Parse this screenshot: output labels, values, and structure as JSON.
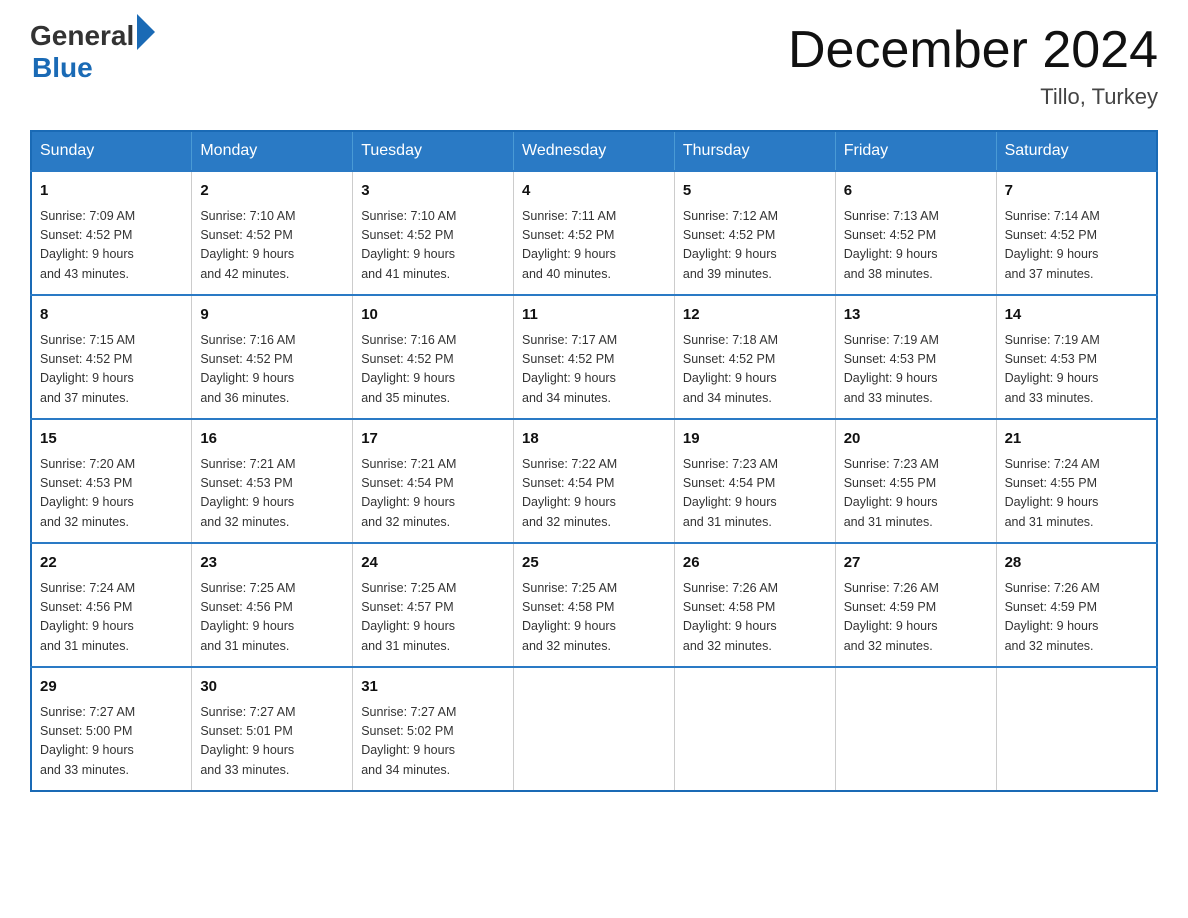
{
  "header": {
    "logo_general": "General",
    "logo_blue": "Blue",
    "month_title": "December 2024",
    "location": "Tillo, Turkey"
  },
  "weekdays": [
    "Sunday",
    "Monday",
    "Tuesday",
    "Wednesday",
    "Thursday",
    "Friday",
    "Saturday"
  ],
  "weeks": [
    [
      {
        "day": "1",
        "sunrise": "7:09 AM",
        "sunset": "4:52 PM",
        "daylight": "9 hours and 43 minutes."
      },
      {
        "day": "2",
        "sunrise": "7:10 AM",
        "sunset": "4:52 PM",
        "daylight": "9 hours and 42 minutes."
      },
      {
        "day": "3",
        "sunrise": "7:10 AM",
        "sunset": "4:52 PM",
        "daylight": "9 hours and 41 minutes."
      },
      {
        "day": "4",
        "sunrise": "7:11 AM",
        "sunset": "4:52 PM",
        "daylight": "9 hours and 40 minutes."
      },
      {
        "day": "5",
        "sunrise": "7:12 AM",
        "sunset": "4:52 PM",
        "daylight": "9 hours and 39 minutes."
      },
      {
        "day": "6",
        "sunrise": "7:13 AM",
        "sunset": "4:52 PM",
        "daylight": "9 hours and 38 minutes."
      },
      {
        "day": "7",
        "sunrise": "7:14 AM",
        "sunset": "4:52 PM",
        "daylight": "9 hours and 37 minutes."
      }
    ],
    [
      {
        "day": "8",
        "sunrise": "7:15 AM",
        "sunset": "4:52 PM",
        "daylight": "9 hours and 37 minutes."
      },
      {
        "day": "9",
        "sunrise": "7:16 AM",
        "sunset": "4:52 PM",
        "daylight": "9 hours and 36 minutes."
      },
      {
        "day": "10",
        "sunrise": "7:16 AM",
        "sunset": "4:52 PM",
        "daylight": "9 hours and 35 minutes."
      },
      {
        "day": "11",
        "sunrise": "7:17 AM",
        "sunset": "4:52 PM",
        "daylight": "9 hours and 34 minutes."
      },
      {
        "day": "12",
        "sunrise": "7:18 AM",
        "sunset": "4:52 PM",
        "daylight": "9 hours and 34 minutes."
      },
      {
        "day": "13",
        "sunrise": "7:19 AM",
        "sunset": "4:53 PM",
        "daylight": "9 hours and 33 minutes."
      },
      {
        "day": "14",
        "sunrise": "7:19 AM",
        "sunset": "4:53 PM",
        "daylight": "9 hours and 33 minutes."
      }
    ],
    [
      {
        "day": "15",
        "sunrise": "7:20 AM",
        "sunset": "4:53 PM",
        "daylight": "9 hours and 32 minutes."
      },
      {
        "day": "16",
        "sunrise": "7:21 AM",
        "sunset": "4:53 PM",
        "daylight": "9 hours and 32 minutes."
      },
      {
        "day": "17",
        "sunrise": "7:21 AM",
        "sunset": "4:54 PM",
        "daylight": "9 hours and 32 minutes."
      },
      {
        "day": "18",
        "sunrise": "7:22 AM",
        "sunset": "4:54 PM",
        "daylight": "9 hours and 32 minutes."
      },
      {
        "day": "19",
        "sunrise": "7:23 AM",
        "sunset": "4:54 PM",
        "daylight": "9 hours and 31 minutes."
      },
      {
        "day": "20",
        "sunrise": "7:23 AM",
        "sunset": "4:55 PM",
        "daylight": "9 hours and 31 minutes."
      },
      {
        "day": "21",
        "sunrise": "7:24 AM",
        "sunset": "4:55 PM",
        "daylight": "9 hours and 31 minutes."
      }
    ],
    [
      {
        "day": "22",
        "sunrise": "7:24 AM",
        "sunset": "4:56 PM",
        "daylight": "9 hours and 31 minutes."
      },
      {
        "day": "23",
        "sunrise": "7:25 AM",
        "sunset": "4:56 PM",
        "daylight": "9 hours and 31 minutes."
      },
      {
        "day": "24",
        "sunrise": "7:25 AM",
        "sunset": "4:57 PM",
        "daylight": "9 hours and 31 minutes."
      },
      {
        "day": "25",
        "sunrise": "7:25 AM",
        "sunset": "4:58 PM",
        "daylight": "9 hours and 32 minutes."
      },
      {
        "day": "26",
        "sunrise": "7:26 AM",
        "sunset": "4:58 PM",
        "daylight": "9 hours and 32 minutes."
      },
      {
        "day": "27",
        "sunrise": "7:26 AM",
        "sunset": "4:59 PM",
        "daylight": "9 hours and 32 minutes."
      },
      {
        "day": "28",
        "sunrise": "7:26 AM",
        "sunset": "4:59 PM",
        "daylight": "9 hours and 32 minutes."
      }
    ],
    [
      {
        "day": "29",
        "sunrise": "7:27 AM",
        "sunset": "5:00 PM",
        "daylight": "9 hours and 33 minutes."
      },
      {
        "day": "30",
        "sunrise": "7:27 AM",
        "sunset": "5:01 PM",
        "daylight": "9 hours and 33 minutes."
      },
      {
        "day": "31",
        "sunrise": "7:27 AM",
        "sunset": "5:02 PM",
        "daylight": "9 hours and 34 minutes."
      },
      null,
      null,
      null,
      null
    ]
  ],
  "labels": {
    "sunrise": "Sunrise:",
    "sunset": "Sunset:",
    "daylight": "Daylight:"
  }
}
